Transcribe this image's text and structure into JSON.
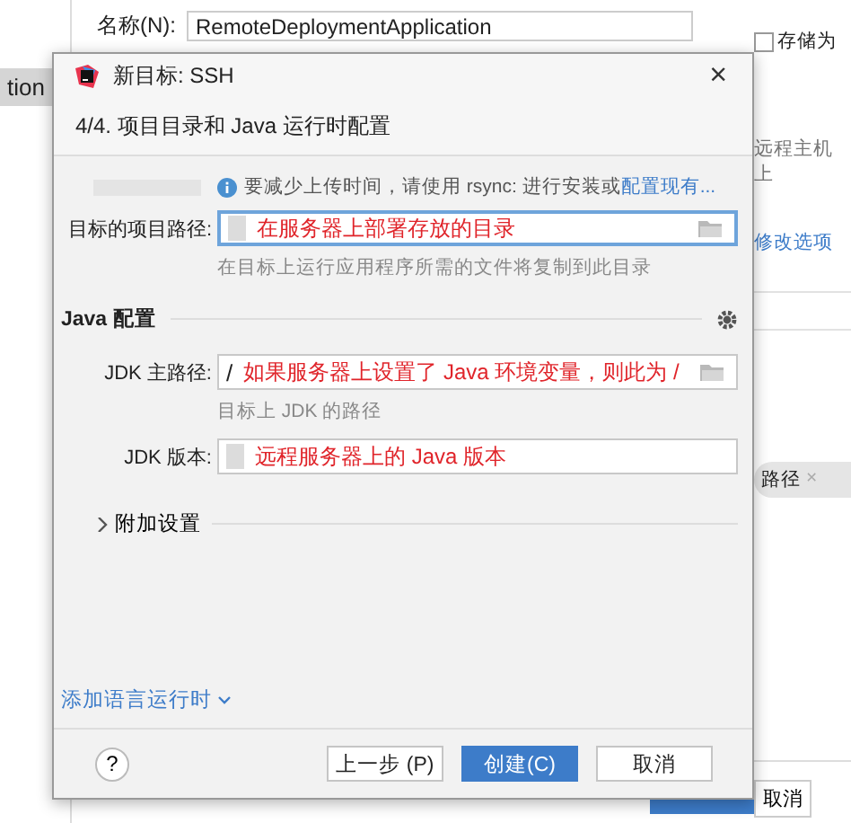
{
  "background": {
    "sidebar_item": {
      "label": "tion",
      "selected": true
    },
    "name_label": "名称(N):",
    "name_value": "RemoteDeploymentApplication",
    "store_checkbox": {
      "label": "存储为",
      "checked": false
    },
    "remote_text": "远程主机上",
    "modify_link": "修改选项",
    "chip": {
      "label": "路径",
      "close": "×"
    },
    "cancel_label": "取消"
  },
  "dialog": {
    "title": "新目标: SSH",
    "close": "×",
    "step": "4/4. 项目目录和 Java 运行时配置",
    "info": {
      "label_redacted": true,
      "text": "要减少上传时间，请使用 rsync: 进行安装或",
      "link": "配置现有..."
    },
    "fields": [
      {
        "kind": "path",
        "label": "目标的项目路径:",
        "redacted": true,
        "annotation": "在服务器上部署存放的目录",
        "focused": true,
        "hint": "在目标上运行应用程序所需的文件将复制到此目录"
      },
      {
        "kind": "section",
        "label": "Java 配置"
      },
      {
        "kind": "path",
        "label": "JDK 主路径:",
        "value": "/",
        "annotation": "如果服务器上设置了 Java 环境变量，则此为 /",
        "focused": false,
        "hint": "目标上 JDK 的路径"
      },
      {
        "kind": "text",
        "label": "JDK 版本:",
        "redacted": true,
        "annotation": "远程服务器上的 Java 版本",
        "focused": false
      }
    ],
    "advanced": {
      "label": "附加设置",
      "expanded": false
    },
    "add_runtime": "添加语言运行时",
    "help": "?",
    "buttons": [
      {
        "label": "上一步 (P)",
        "kind": "secondary"
      },
      {
        "label": "创建(C)",
        "kind": "primary"
      },
      {
        "label": "取消",
        "kind": "secondary"
      }
    ]
  }
}
